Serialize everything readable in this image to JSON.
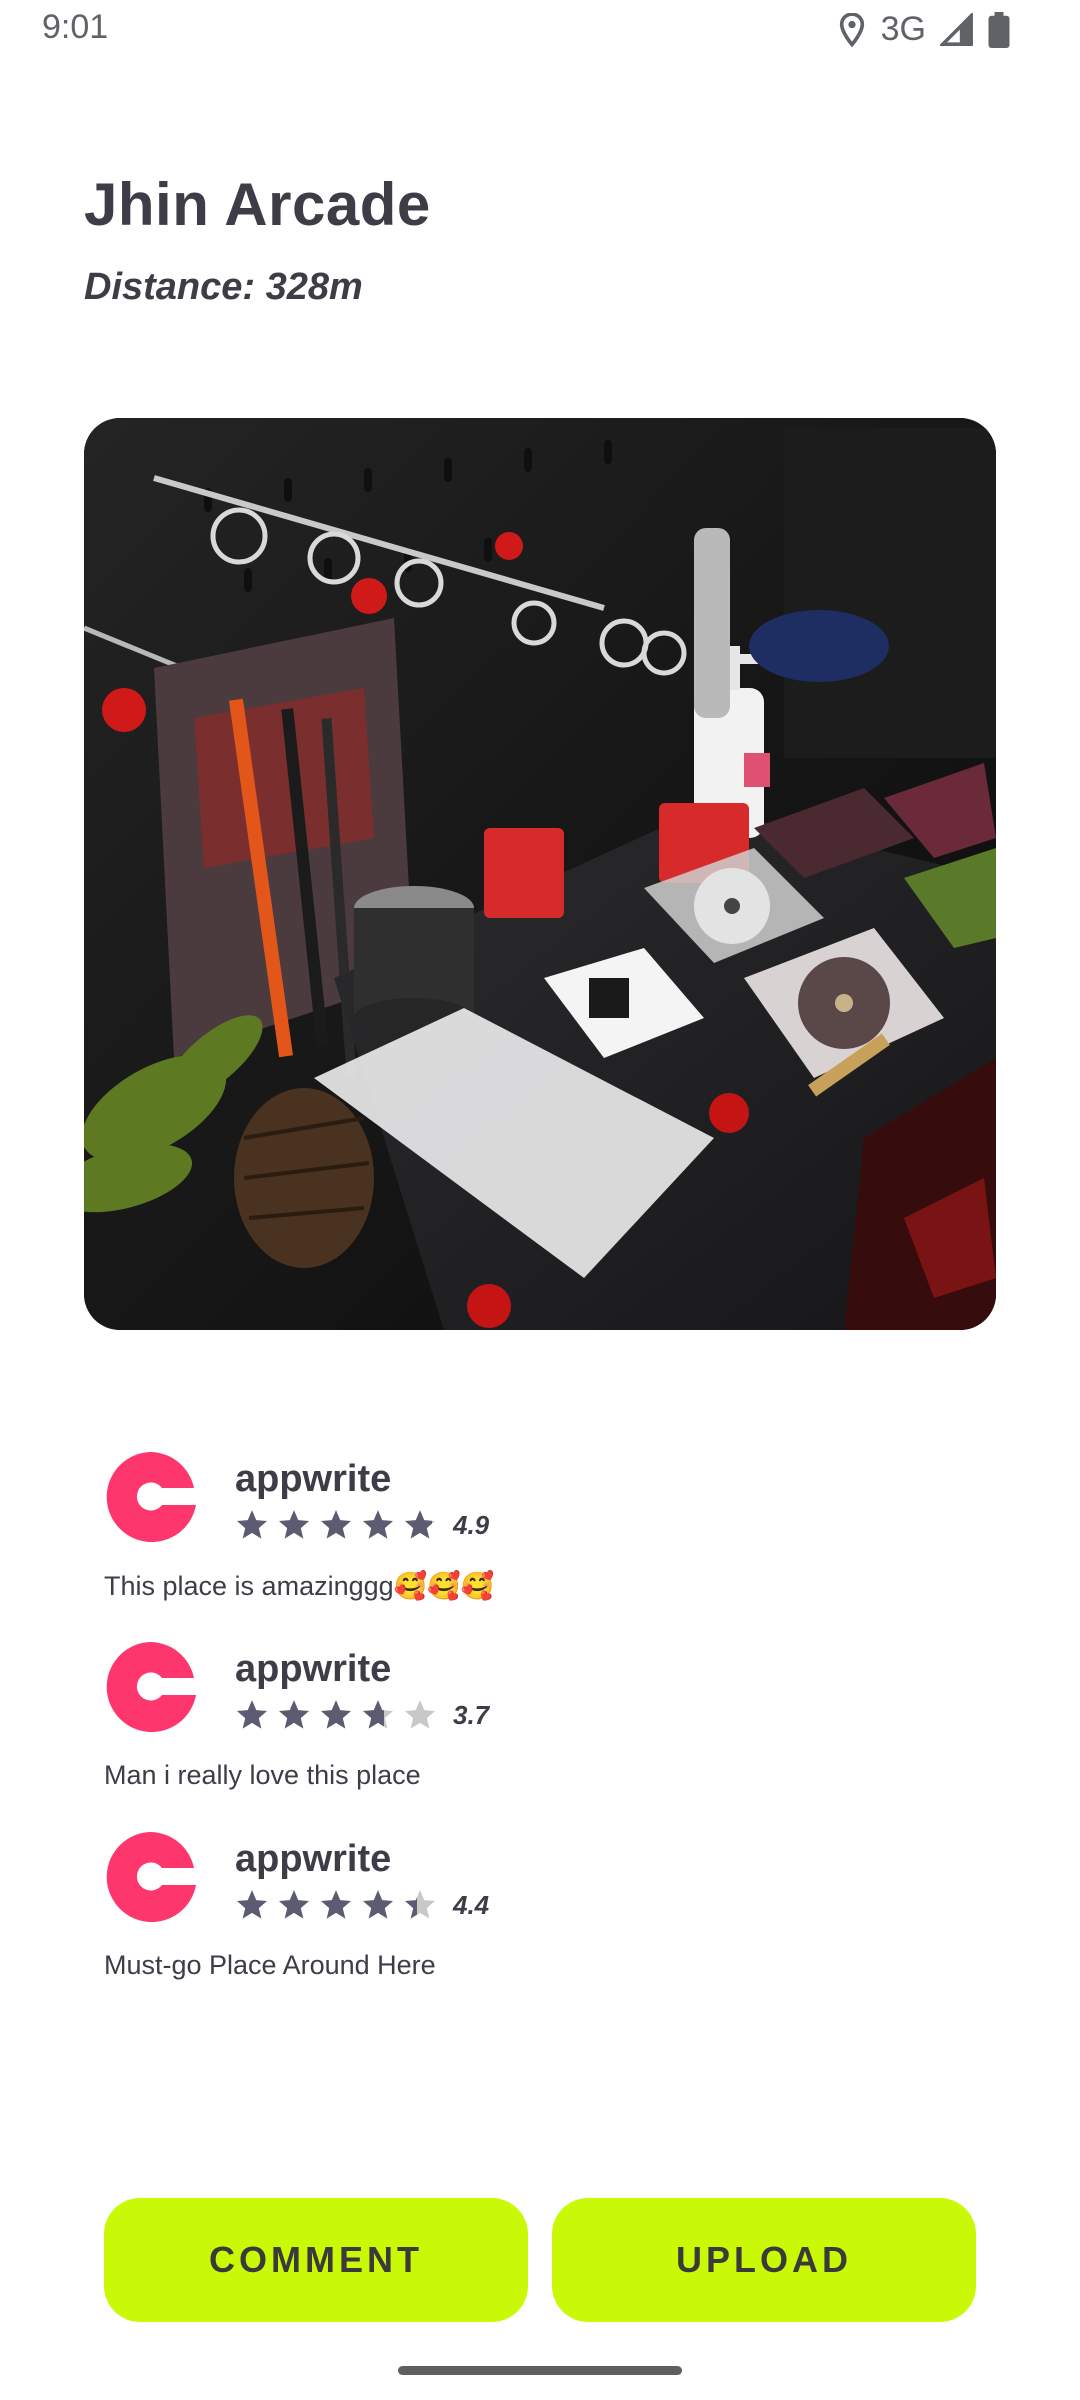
{
  "status_bar": {
    "time": "9:01",
    "network": "3G",
    "icons": [
      "location-icon",
      "signal-icon",
      "battery-icon"
    ]
  },
  "place": {
    "name": "Jhin Arcade",
    "distance": "Distance: 328m"
  },
  "photo": {
    "description_icon": "photo"
  },
  "reviews": [
    {
      "author": "appwrite",
      "rating": 4.9,
      "rating_text": "4.9",
      "text": "This place is amazinggg🥰🥰🥰"
    },
    {
      "author": "appwrite",
      "rating": 3.7,
      "rating_text": "3.7",
      "text": "Man i really love this place"
    },
    {
      "author": "appwrite",
      "rating": 4.4,
      "rating_text": "4.4",
      "text": "Must-go Place Around Here"
    }
  ],
  "actions": {
    "comment_label": "COMMENT",
    "upload_label": "UPLOAD"
  },
  "colors": {
    "accent": "#c9f906",
    "avatar_brand": "#fd366e",
    "star_filled": "#5b5b72",
    "star_empty": "#c8c8c8"
  }
}
